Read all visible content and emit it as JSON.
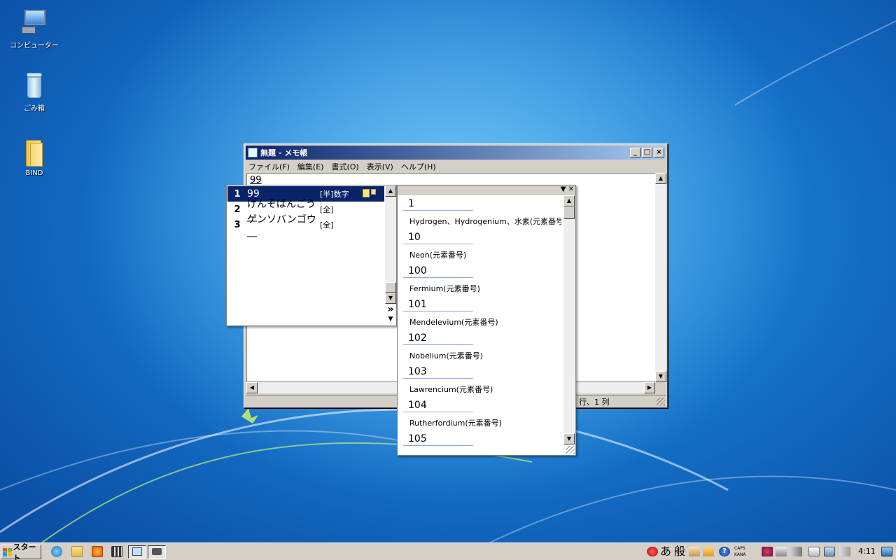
{
  "desktop": {
    "icons": [
      {
        "label": "コンピューター",
        "icon": "computer-icon"
      },
      {
        "label": "ごみ箱",
        "icon": "recycle-bin-icon"
      },
      {
        "label": "BIND",
        "icon": "folder-icon"
      }
    ]
  },
  "notepad": {
    "title": "無題 - メモ帳",
    "menu": [
      "ファイル(F)",
      "編集(E)",
      "書式(O)",
      "表示(V)",
      "ヘルプ(H)"
    ],
    "content": "99",
    "status_position": "行、1 列"
  },
  "ime": {
    "candidates": [
      {
        "num": "1",
        "word": "99",
        "tag": "[半]数字",
        "selected": true
      },
      {
        "num": "2",
        "word": "げんそばんごう__",
        "tag": "[全]",
        "selected": false
      },
      {
        "num": "3",
        "word": "ゲンソバンゴウ__",
        "tag": "[全]",
        "selected": false
      }
    ],
    "expand_symbol": "»",
    "dictionary": [
      {
        "term": "1",
        "desc": "Hydrogen、Hydrogenium、水素(元素番号)"
      },
      {
        "term": "10",
        "desc": "Neon(元素番号)"
      },
      {
        "term": "100",
        "desc": "Fermium(元素番号)"
      },
      {
        "term": "101",
        "desc": "Mendelevium(元素番号)"
      },
      {
        "term": "102",
        "desc": "Nobelium(元素番号)"
      },
      {
        "term": "103",
        "desc": "Lawrencium(元素番号)"
      },
      {
        "term": "104",
        "desc": "Rutherfordium(元素番号)"
      },
      {
        "term": "105",
        "desc": ""
      }
    ]
  },
  "taskbar": {
    "start_label": "スタート",
    "ime_mode": "あ",
    "ime_dict": "般",
    "caps_label": "CAPS",
    "kana_label": "KANA",
    "clock": "4:11"
  },
  "colors": {
    "selection": "#0a246a",
    "titlebar_start": "#0a246a",
    "titlebar_end": "#a6caf0",
    "desktop_blue": "#1470c8"
  }
}
